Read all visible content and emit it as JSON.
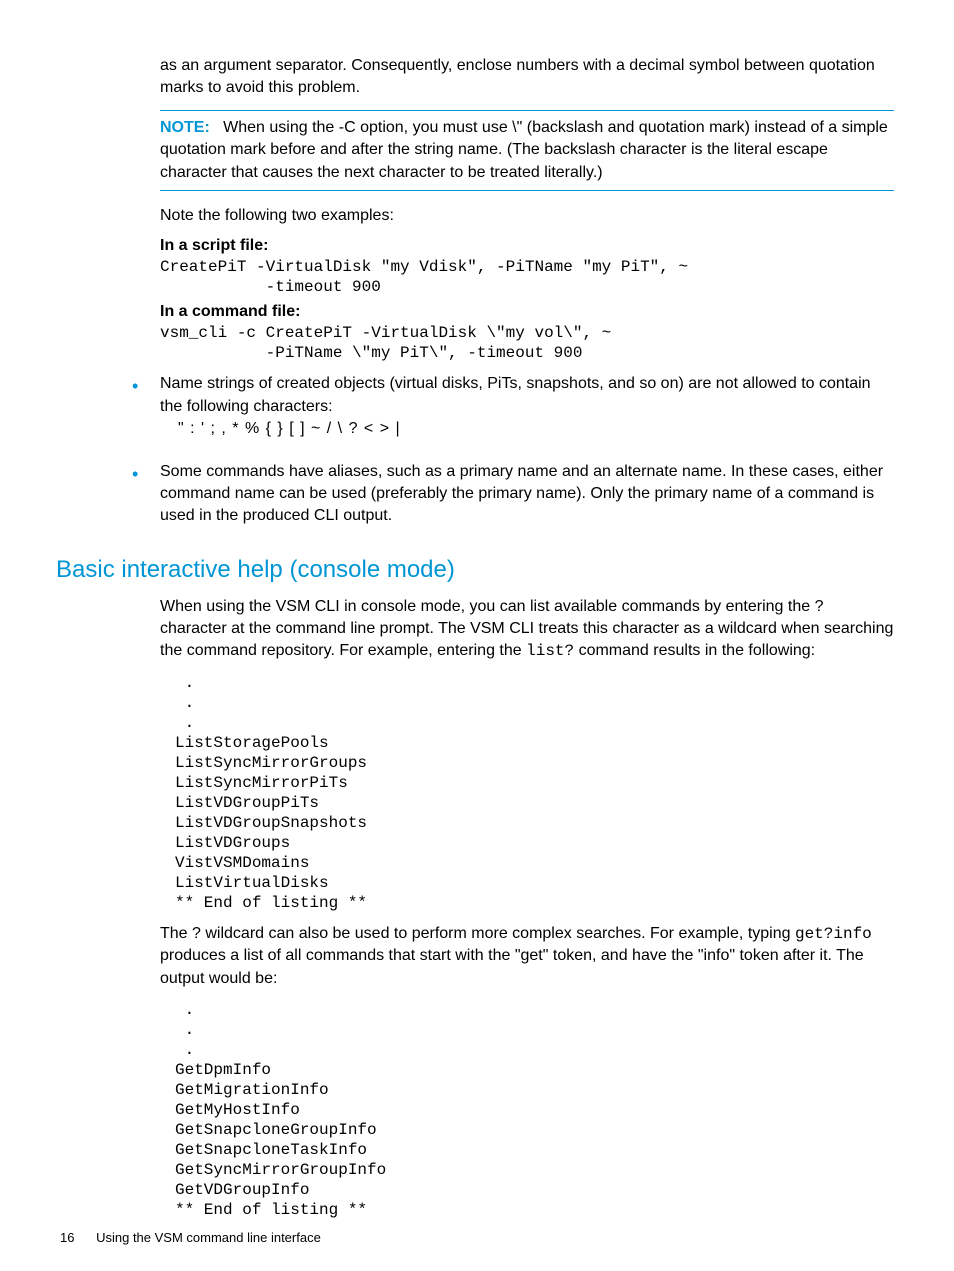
{
  "para1": "as an argument separator. Consequently, enclose numbers with a decimal symbol between quotation marks to avoid this problem.",
  "note": {
    "label": "NOTE:",
    "text": "When using the -C option, you must use \\\" (backslash and quotation mark) instead of a simple quotation mark before and after the string name. (The backslash character is the literal escape character that causes the next character to be treated literally.)"
  },
  "para2": "Note the following two examples:",
  "scriptLabel": "In a script file:",
  "scriptCode": "CreatePiT -VirtualDisk \"my Vdisk\", -PiTName \"my PiT\", ~\n           -timeout 900",
  "cmdLabel": "In a command file:",
  "cmdCode": "vsm_cli -c CreatePiT -VirtualDisk \\\"my vol\\\", ~\n           -PiTName \\\"my PiT\\\", -timeout 900",
  "bullet1": {
    "text": "Name strings of created objects (virtual disks, PiTs, snapshots, and so on) are not allowed to contain the following characters:",
    "chars": "\" : ' ; , * % { } [ ] ~ / \\ ? < > |"
  },
  "bullet2": "Some commands have aliases, such as a primary name and an alternate name. In these cases, either command name can be used (preferably the primary name). Only the primary name of a command is used in the produced CLI output.",
  "heading": "Basic interactive help (console mode)",
  "para3_a": "When using the VSM CLI in console mode, you can list available commands by entering the ? character at the command line prompt. The VSM CLI treats this character as a wildcard when searching the command repository. For example, entering the ",
  "para3_code": "list?",
  "para3_b": " command results in the following:",
  "listing1": " .\n .\n .\nListStoragePools\nListSyncMirrorGroups\nListSyncMirrorPiTs\nListVDGroupPiTs\nListVDGroupSnapshots\nListVDGroups\nVistVSMDomains\nListVirtualDisks\n** End of listing **",
  "para4_a": "The ? wildcard can also be used to perform more complex searches. For example, typing ",
  "para4_code": "get?info",
  "para4_b": " produces a list of all commands that start with the \"get\" token, and have the \"info\" token after it. The output would be:",
  "listing2": " .\n .\n .\nGetDpmInfo\nGetMigrationInfo\nGetMyHostInfo\nGetSnapcloneGroupInfo\nGetSnapcloneTaskInfo\nGetSyncMirrorGroupInfo\nGetVDGroupInfo\n** End of listing **",
  "footer": {
    "page": "16",
    "title": "Using the VSM command line interface"
  }
}
